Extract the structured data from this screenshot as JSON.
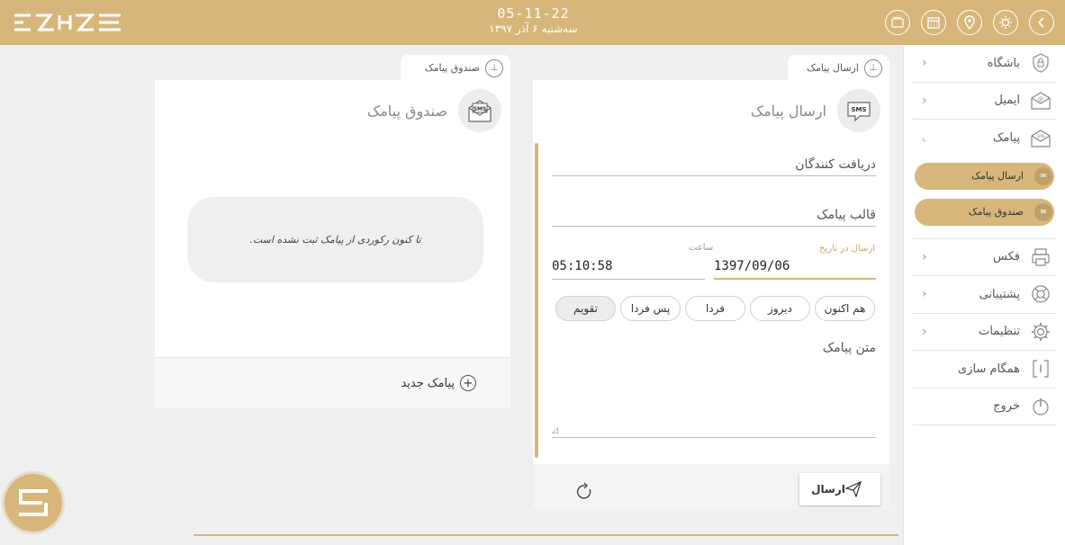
{
  "header": {
    "time": "05-11-22",
    "date": "سه‌شنبه ۶ آذر ۱۳۹۷",
    "icons": [
      "back-icon",
      "theme-icon",
      "location-icon",
      "calendar-icon",
      "layers-icon"
    ]
  },
  "sidebar": {
    "items": [
      {
        "label": "باشگاه",
        "icon": "lock-icon"
      },
      {
        "label": "ایمیل",
        "icon": "email-icon"
      },
      {
        "label": "پیامک",
        "icon": "sms-icon"
      },
      {
        "label": "فکس",
        "icon": "fax-icon"
      },
      {
        "label": "پشتیبانی",
        "icon": "support-icon"
      },
      {
        "label": "تنظیمات",
        "icon": "settings-icon"
      },
      {
        "label": "همگام سازی",
        "icon": "sync-icon"
      },
      {
        "label": "خروج",
        "icon": "power-icon"
      }
    ],
    "sub_items": [
      {
        "label": "ارسال پیامک"
      },
      {
        "label": "صندوق پیامک"
      }
    ]
  },
  "inbox_panel": {
    "tab_label": "صندوق پیامک",
    "title": "صندوق پیامک",
    "icon_text": "SMS",
    "empty_message": "تا کنون رکوردی از پیامک ثبت نشده است.",
    "new_sms_label": "پیامک جدید"
  },
  "send_panel": {
    "tab_label": "ارسال پیامک",
    "title": "ارسال پیامک",
    "icon_text": "SMS",
    "recipients_label": "دریافت کنندگان",
    "template_label": "قالب پیامک",
    "date_label": "ارسال در تاریخ",
    "time_label": "ساعت",
    "date_value": "1397/09/06",
    "time_value": "05:10:58",
    "quick_buttons": [
      "هم اکنون",
      "دیروز",
      "فردا",
      "پس فردا",
      "تقویم"
    ],
    "message_label": "متن پیامک",
    "send_label": "ارسال"
  },
  "colors": {
    "accent": "#d6b67a",
    "background": "#efefef"
  }
}
